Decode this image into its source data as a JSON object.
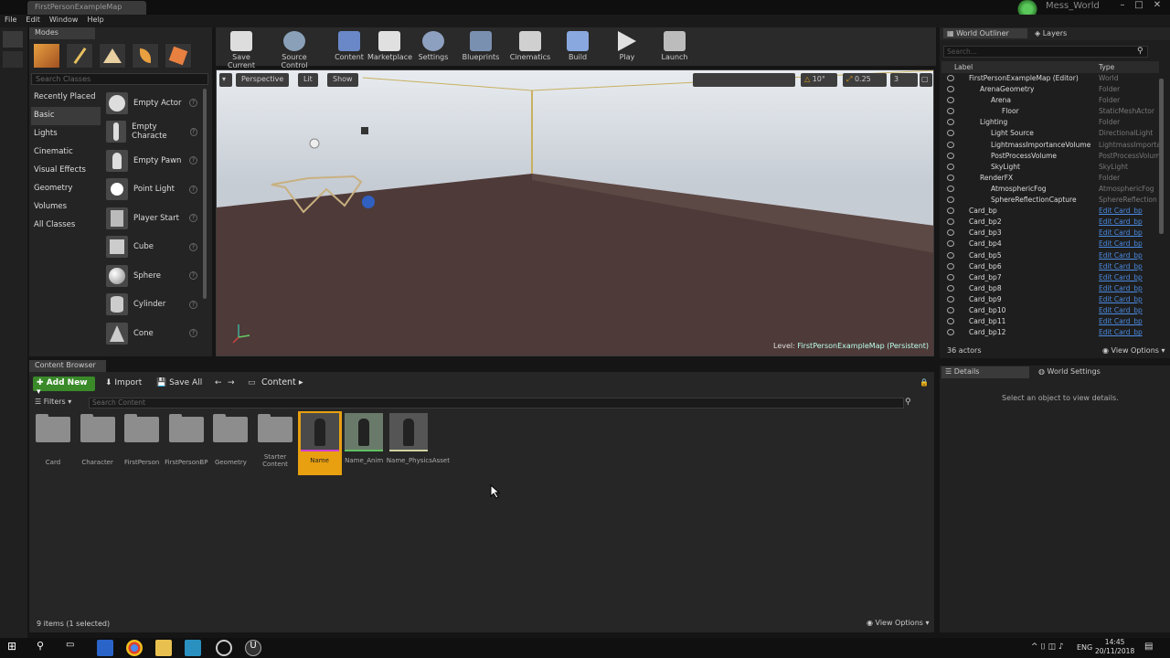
{
  "window": {
    "doc_tab": "FirstPersonExampleMap",
    "project": "Mess_World"
  },
  "menu": [
    "File",
    "Edit",
    "Window",
    "Help"
  ],
  "modes": {
    "tab": "Modes",
    "search_placeholder": "Search Classes",
    "categories": [
      "Recently Placed",
      "Basic",
      "Lights",
      "Cinematic",
      "Visual Effects",
      "Geometry",
      "Volumes",
      "All Classes"
    ],
    "selected_category": "Basic",
    "items": [
      "Empty Actor",
      "Empty Characte",
      "Empty Pawn",
      "Point Light",
      "Player Start",
      "Cube",
      "Sphere",
      "Cylinder",
      "Cone"
    ]
  },
  "toolbar": [
    "Save Current",
    "Source Control",
    "Content",
    "Marketplace",
    "Settings",
    "Blueprints",
    "Cinematics",
    "Build",
    "Play",
    "Launch"
  ],
  "viewport": {
    "perspective": "Perspective",
    "lit": "Lit",
    "show": "Show",
    "snap_angle": "10°",
    "scale": "0.25",
    "cam_speed": "3",
    "level_prefix": "Level:",
    "level_name": "FirstPersonExampleMap (Persistent)"
  },
  "outliner": {
    "tab": "World Outliner",
    "layers_tab": "Layers",
    "search_placeholder": "Search...",
    "col_label": "Label",
    "col_type": "Type",
    "rows": [
      {
        "label": "FirstPersonExampleMap (Editor)",
        "type": "World",
        "depth": 0
      },
      {
        "label": "ArenaGeometry",
        "type": "Folder",
        "depth": 1
      },
      {
        "label": "Arena",
        "type": "Folder",
        "depth": 2
      },
      {
        "label": "Floor",
        "type": "StaticMeshActor",
        "depth": 3
      },
      {
        "label": "Lighting",
        "type": "Folder",
        "depth": 1
      },
      {
        "label": "Light Source",
        "type": "DirectionalLight",
        "depth": 2
      },
      {
        "label": "LightmassImportanceVolume",
        "type": "LightmassImporta",
        "depth": 2
      },
      {
        "label": "PostProcessVolume",
        "type": "PostProcessVolume",
        "depth": 2
      },
      {
        "label": "SkyLight",
        "type": "SkyLight",
        "depth": 2
      },
      {
        "label": "RenderFX",
        "type": "Folder",
        "depth": 1
      },
      {
        "label": "AtmosphericFog",
        "type": "AtmosphericFog",
        "depth": 2
      },
      {
        "label": "SphereReflectionCapture",
        "type": "SphereReflection",
        "depth": 2
      },
      {
        "label": "Card_bp",
        "type": "Edit Card_bp",
        "depth": 0
      },
      {
        "label": "Card_bp2",
        "type": "Edit Card_bp",
        "depth": 0
      },
      {
        "label": "Card_bp3",
        "type": "Edit Card_bp",
        "depth": 0
      },
      {
        "label": "Card_bp4",
        "type": "Edit Card_bp",
        "depth": 0
      },
      {
        "label": "Card_bp5",
        "type": "Edit Card_bp",
        "depth": 0
      },
      {
        "label": "Card_bp6",
        "type": "Edit Card_bp",
        "depth": 0
      },
      {
        "label": "Card_bp7",
        "type": "Edit Card_bp",
        "depth": 0
      },
      {
        "label": "Card_bp8",
        "type": "Edit Card_bp",
        "depth": 0
      },
      {
        "label": "Card_bp9",
        "type": "Edit Card_bp",
        "depth": 0
      },
      {
        "label": "Card_bp10",
        "type": "Edit Card_bp",
        "depth": 0
      },
      {
        "label": "Card_bp11",
        "type": "Edit Card_bp",
        "depth": 0
      },
      {
        "label": "Card_bp12",
        "type": "Edit Card_bp",
        "depth": 0
      }
    ],
    "actor_count": "36 actors",
    "view_options": "View Options"
  },
  "details": {
    "tab": "Details",
    "world_settings": "World Settings",
    "hint": "Select an object to view details."
  },
  "content_browser": {
    "tab": "Content Browser",
    "add_new": "Add New",
    "import": "Import",
    "save_all": "Save All",
    "path": "Content",
    "filters": "Filters",
    "search_placeholder": "Search Content",
    "assets": [
      {
        "name": "Card",
        "kind": "folder"
      },
      {
        "name": "Character",
        "kind": "folder"
      },
      {
        "name": "FirstPerson",
        "kind": "folder"
      },
      {
        "name": "FirstPersonBP",
        "kind": "folder"
      },
      {
        "name": "Geometry",
        "kind": "folder"
      },
      {
        "name": "Starter Content",
        "kind": "folder"
      },
      {
        "name": "Name",
        "kind": "mesh",
        "selected": true
      },
      {
        "name": "Name_Anim",
        "kind": "anim"
      },
      {
        "name": "Name_PhysicsAsset",
        "kind": "physics"
      }
    ],
    "items_count": "9 items (1 selected)",
    "view_options": "View Options"
  },
  "taskbar": {
    "lang": "ENG",
    "time": "14:45",
    "date": "20/11/2018"
  },
  "colors": {
    "accent": "#e8a010",
    "add_new": "#3a8a2a",
    "link": "#4a8ae0"
  }
}
